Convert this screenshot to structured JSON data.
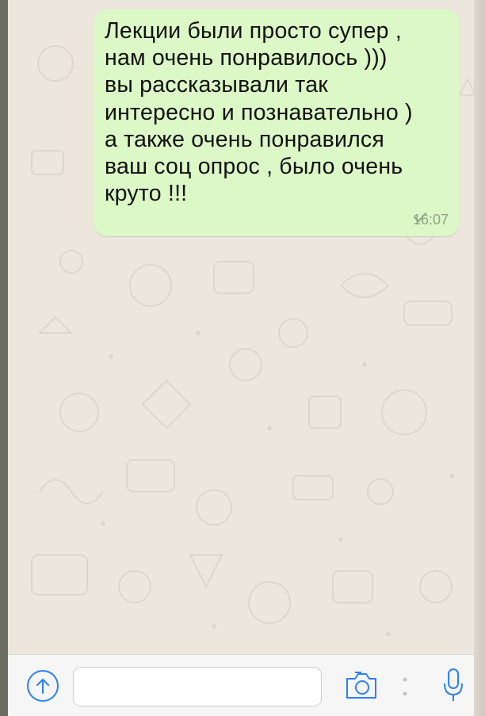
{
  "message": {
    "text": "Лекции были просто супер ,\nнам очень понравилось )))\nвы рассказывали так\nинтересно и познавательно )\nа также очень понравился\nваш соц опрос , было очень\nкруто !!!",
    "time": "16:07",
    "status_icon": "check-icon"
  },
  "input_bar": {
    "attach_icon": "arrow-up-circle-icon",
    "text_value": "",
    "camera_icon": "camera-icon",
    "mic_icon": "microphone-icon"
  },
  "colors": {
    "bubble": "#dcf8c6",
    "chat_background": "#ece6dc",
    "accent": "#2d7ff9"
  }
}
